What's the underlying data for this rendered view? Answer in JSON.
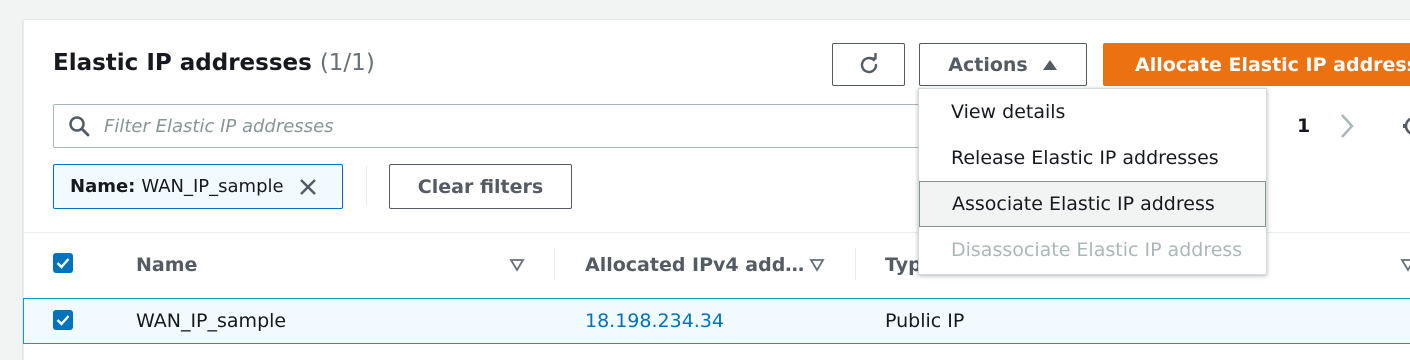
{
  "header": {
    "title": "Elastic IP addresses",
    "count": "(1/1)",
    "actions_label": "Actions",
    "allocate_label": "Allocate Elastic IP address"
  },
  "search": {
    "placeholder": "Filter Elastic IP addresses",
    "value": ""
  },
  "pagination": {
    "current_page": "1"
  },
  "filters": {
    "chips": [
      {
        "key": "Name:",
        "value": "WAN_IP_sample"
      }
    ],
    "clear_label": "Clear filters"
  },
  "table": {
    "columns": [
      "Name",
      "Allocated IPv4 add…",
      "Typ"
    ],
    "rows": [
      {
        "name": "WAN_IP_sample",
        "ip": "18.198.234.34",
        "type": "Public IP",
        "selected": true
      }
    ]
  },
  "actions_menu": {
    "items": [
      {
        "label": "View details",
        "state": "normal"
      },
      {
        "label": "Release Elastic IP addresses",
        "state": "normal"
      },
      {
        "label": "Associate Elastic IP address",
        "state": "highlighted"
      },
      {
        "label": "Disassociate Elastic IP address",
        "state": "disabled"
      }
    ]
  },
  "colors": {
    "accent": "#ec7211",
    "link": "#0073bb",
    "selected_row": "#f1faff"
  },
  "icons": [
    "refresh-icon",
    "caret-up-icon",
    "search-icon",
    "chevron-right-icon",
    "gear-icon",
    "close-icon",
    "sort-icon",
    "checkbox-checked-icon"
  ]
}
